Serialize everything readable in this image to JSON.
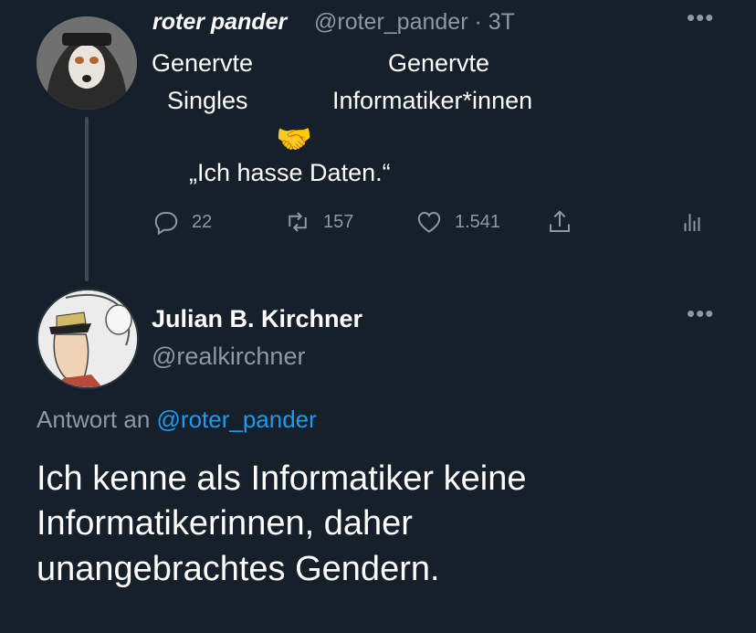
{
  "tweet1": {
    "display_name": "roter pander",
    "handle": "@roter_pander",
    "separator": "·",
    "time": "3T",
    "more": "•••",
    "lines": {
      "left1": "Genervte",
      "right1": "Genervte",
      "left2": "Singles",
      "right2": "Informatiker*innen",
      "emoji": "🤝",
      "quote": "„Ich hasse Daten.“"
    },
    "actions": {
      "reply_count": "22",
      "retweet_count": "157",
      "like_count": "1.541"
    }
  },
  "tweet2": {
    "display_name": "Julian B. Kirchner",
    "handle": "@realkirchner",
    "more": "•••",
    "reply_prefix": "Antwort an",
    "reply_mention": "@roter_pander",
    "body_lines": [
      "Ich kenne als Informatiker keine",
      "Informatikerinnen, daher",
      "unangebrachtes Gendern."
    ]
  },
  "colors": {
    "background": "#15202b",
    "secondary_text": "#8b98a5",
    "link": "#1d9bf0"
  },
  "icons": [
    "reply-icon",
    "retweet-icon",
    "like-icon",
    "share-icon",
    "analytics-icon",
    "more-icon"
  ]
}
